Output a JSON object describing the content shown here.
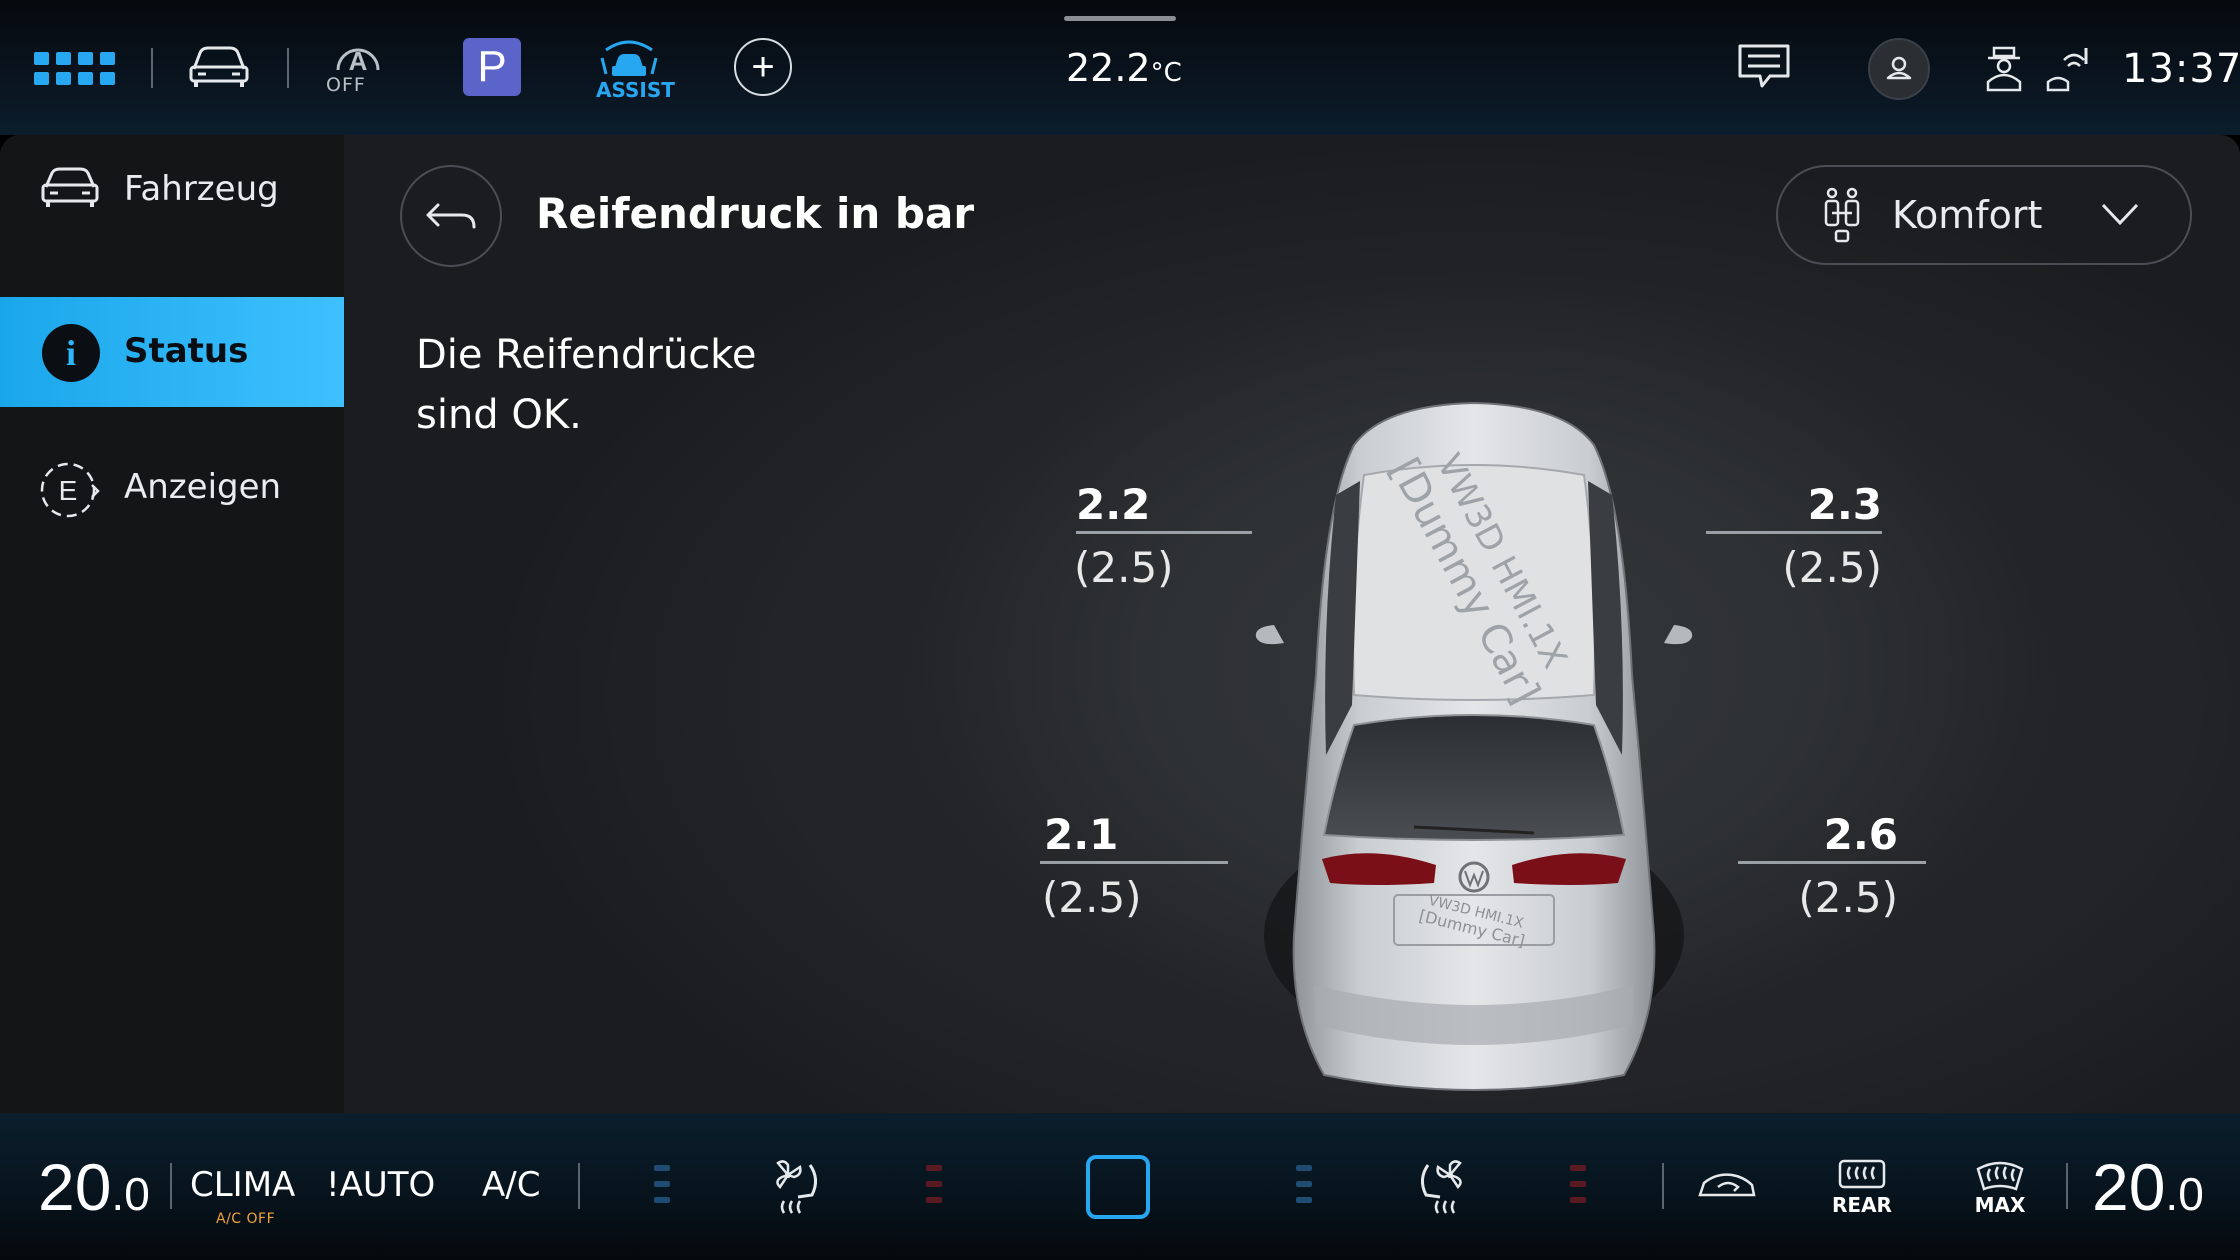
{
  "top_bar": {
    "auto_hold_label": "OFF",
    "park_label": "P",
    "assist_label": "ASSIST",
    "plus_label": "+",
    "outside_temp": "22.2",
    "outside_temp_unit": "°C",
    "clock": "13:37"
  },
  "sidebar": {
    "items": [
      {
        "label": "Fahrzeug",
        "icon": "car-icon"
      },
      {
        "label": "Status",
        "icon": "info-icon",
        "active": true
      },
      {
        "label": "Anzeigen",
        "icon": "e-display-icon"
      }
    ],
    "status_icon_glyph": "i",
    "anzeigen_icon_glyph": "E"
  },
  "page": {
    "title": "Reifendruck in bar",
    "profile_dropdown": "Komfort",
    "status_line1": "Die Reifendrücke",
    "status_line2": "sind OK."
  },
  "tires": {
    "front_left": {
      "value": "2.2",
      "target": "(2.5)"
    },
    "front_right": {
      "value": "2.3",
      "target": "(2.5)"
    },
    "rear_left": {
      "value": "2.1",
      "target": "(2.5)"
    },
    "rear_right": {
      "value": "2.6",
      "target": "(2.5)"
    }
  },
  "car_render": {
    "roof_text_line1": "VW3D HMI.1X",
    "roof_text_line2": "[Dummy Car]"
  },
  "climate": {
    "left_temp_int": "20",
    "left_temp_dec": ".0",
    "right_temp_int": "20",
    "right_temp_dec": ".0",
    "clima_label": "CLIMA",
    "ac_off_label": "A/C OFF",
    "auto_label": "!AUTO",
    "ac_label": "A/C",
    "rear_label": "REAR",
    "max_label": "MAX"
  },
  "colors": {
    "accent_blue": "#27a7f0",
    "park_purple": "#5b65c9",
    "ac_off_orange": "#f2a33a",
    "heat_red": "#a3202c"
  }
}
